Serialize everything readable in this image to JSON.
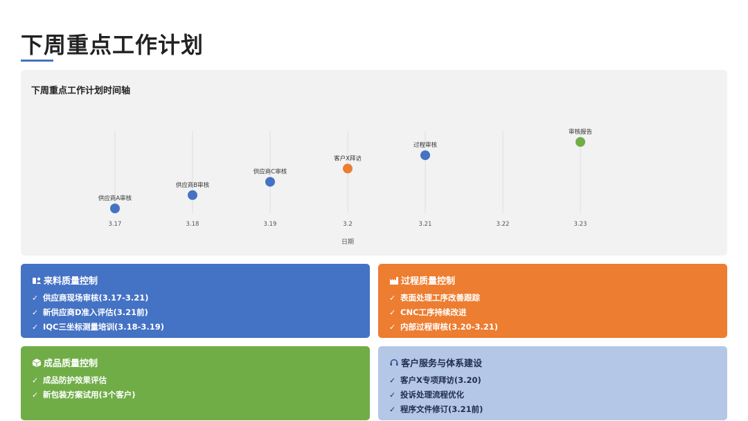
{
  "page": {
    "title": "下周重点工作计划"
  },
  "chart_data": {
    "type": "scatter",
    "title": "下周重点工作计划时间轴",
    "xlabel": "日期",
    "ylabel": "",
    "x_ticks": [
      "3.17",
      "3.18",
      "3.19",
      "3.2",
      "3.21",
      "3.22",
      "3.23"
    ],
    "points": [
      {
        "x": "3.17",
        "label": "供应商A审核",
        "level": 1,
        "color": "#4472c4"
      },
      {
        "x": "3.18",
        "label": "供应商B审核",
        "level": 2,
        "color": "#4472c4"
      },
      {
        "x": "3.19",
        "label": "供应商C审核",
        "level": 3,
        "color": "#4472c4"
      },
      {
        "x": "3.2",
        "label": "客户X拜访",
        "level": 4,
        "color": "#ed7d31"
      },
      {
        "x": "3.21",
        "label": "过程审核",
        "level": 5,
        "color": "#4472c4"
      },
      {
        "x": "3.23",
        "label": "审核报告",
        "level": 6,
        "color": "#70ad47"
      }
    ],
    "grid": "vertical"
  },
  "cards": [
    {
      "title": "来料质量控制",
      "icon": "clipboard-users-icon",
      "bg": "#4472c4",
      "items": [
        "供应商现场审核(3.17-3.21)",
        "新供应商D准入评估(3.21前)",
        "IQC三坐标测量培训(3.18-3.19)"
      ]
    },
    {
      "title": "过程质量控制",
      "icon": "factory-icon",
      "bg": "#ed7d31",
      "items": [
        "表面处理工序改善跟踪",
        "CNC工序持续改进",
        "内部过程审核(3.20-3.21)"
      ]
    },
    {
      "title": "成品质量控制",
      "icon": "box-icon",
      "bg": "#70ad47",
      "items": [
        "成品防护效果评估",
        "新包装方案试用(3个客户)"
      ]
    },
    {
      "title": "客户服务与体系建设",
      "icon": "headset-icon",
      "bg": "#b4c7e7",
      "items": [
        "客户X专项拜访(3.20)",
        "投诉处理流程优化",
        "程序文件修订(3.21前)"
      ]
    }
  ]
}
